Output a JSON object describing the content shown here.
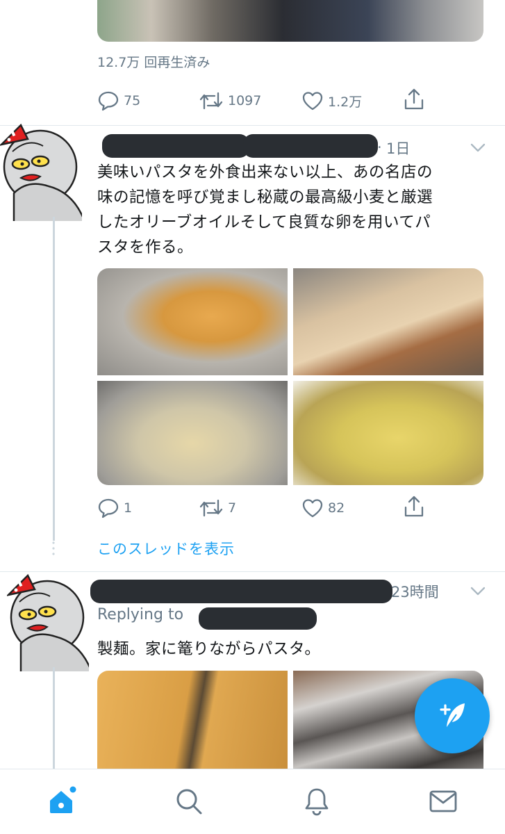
{
  "prev_tweet": {
    "views": "12.7万 回再生済み",
    "replies": "75",
    "retweets": "1097",
    "likes": "1.2万"
  },
  "tweet1": {
    "time": "1日",
    "text_lines": [
      "美味いパスタを外食出来ない以上、あの名店の",
      "味の記憶を呼び覚まし秘蔵の最高級小麦と厳選",
      "したオリーブオイルそして良質な卵を用いてパ",
      "スタを作る。"
    ],
    "replies": "1",
    "retweets": "7",
    "likes": "82",
    "show_thread": "このスレッドを表示"
  },
  "tweet2": {
    "time": "23時間",
    "replying_to": "Replying to",
    "text": "製麺。家に篭りながらパスタ。"
  },
  "icons": {
    "reply": "reply-icon",
    "retweet": "retweet-icon",
    "like": "heart-icon",
    "share": "share-icon",
    "compose": "compose-tweet-icon",
    "home": "home-icon",
    "search": "search-icon",
    "notifications": "bell-icon",
    "messages": "mail-icon"
  },
  "colors": {
    "accent": "#1da1f2",
    "muted": "#657786",
    "redaction": "#2a2e33"
  }
}
